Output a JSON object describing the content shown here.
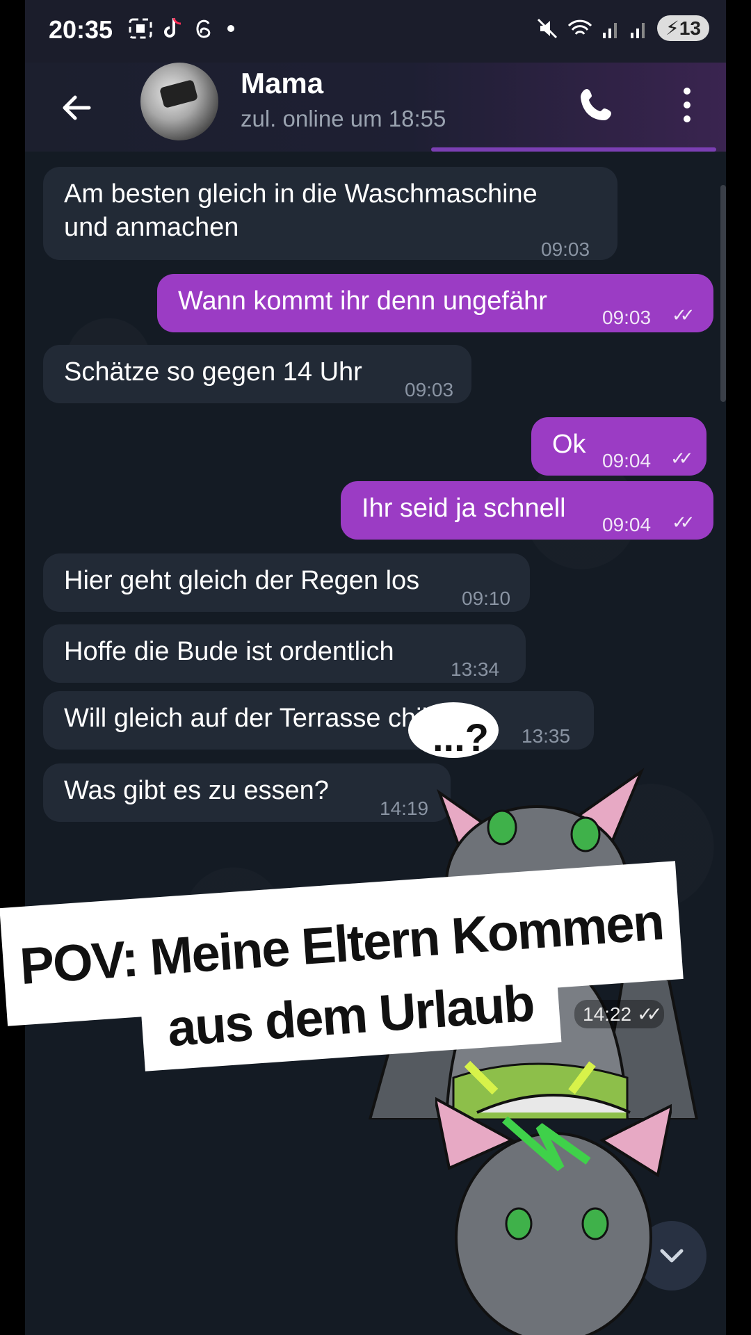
{
  "status_bar": {
    "time": "20:35",
    "battery": "13",
    "icons_left": [
      "screenshot-icon",
      "tiktok-icon",
      "threads-icon",
      "dot-icon"
    ],
    "icons_right": [
      "mute-icon",
      "wifi-icon",
      "signal-icon",
      "signal-icon",
      "battery-icon"
    ]
  },
  "header": {
    "title": "Mama",
    "subtitle": "zul. online um 18:55"
  },
  "messages": [
    {
      "dir": "in",
      "lines": [
        "Am besten gleich in die Waschmaschine",
        "und anmachen"
      ],
      "time": "09:03"
    },
    {
      "dir": "out",
      "lines": [
        "Wann kommt ihr denn ungefähr"
      ],
      "time": "09:03",
      "read": true
    },
    {
      "dir": "in",
      "lines": [
        "Schätze so gegen 14 Uhr"
      ],
      "time": "09:03"
    },
    {
      "dir": "out",
      "lines": [
        "Ok"
      ],
      "time": "09:04",
      "read": true
    },
    {
      "dir": "out",
      "lines": [
        "Ihr seid ja schnell"
      ],
      "time": "09:04",
      "read": true
    },
    {
      "dir": "in",
      "lines": [
        "Hier geht gleich der Regen los"
      ],
      "time": "09:10"
    },
    {
      "dir": "in",
      "lines": [
        "Hoffe die Bude ist ordentlich"
      ],
      "time": "13:34"
    },
    {
      "dir": "in",
      "lines": [
        "Will gleich auf der Terrasse chillen"
      ],
      "time": "13:35"
    },
    {
      "dir": "in",
      "lines": [
        "Was gibt es zu essen?"
      ],
      "time": "14:19"
    }
  ],
  "sticker": {
    "time": "14:22",
    "bubble_text": "...?"
  },
  "caption": {
    "line1": "POV: Meine Eltern Kommen",
    "line2": "aus dem Urlaub"
  },
  "colors": {
    "outgoing_bubble": "#9b3cc4",
    "incoming_bubble": "#222a36",
    "background": "#141b24"
  }
}
